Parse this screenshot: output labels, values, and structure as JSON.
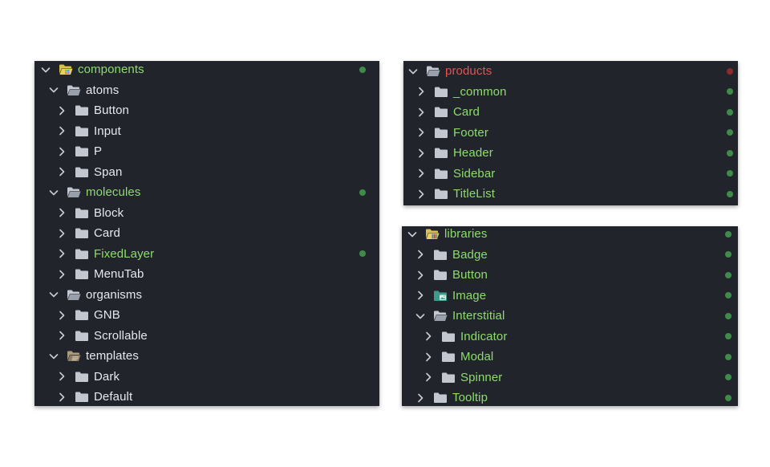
{
  "colors": {
    "panel_bg": "#22242c",
    "text_default": "#e6e8ee",
    "text_modified": "#8ddc6b",
    "text_error": "#e5524f",
    "folder_icon": "#c3c7d0",
    "dot_green": "#3f8c4a",
    "dot_red": "#8c2b2b",
    "chevron": "#c8cbd3"
  },
  "left_panel": {
    "items": [
      {
        "label": "components",
        "depth": 0,
        "expanded": true,
        "color": "green",
        "icon": "components-folder-icon",
        "dot": "green"
      },
      {
        "label": "atoms",
        "depth": 1,
        "expanded": true,
        "color": "default",
        "icon": "folder-open-icon"
      },
      {
        "label": "Button",
        "depth": 2,
        "expanded": false,
        "color": "default",
        "icon": "folder-icon"
      },
      {
        "label": "Input",
        "depth": 2,
        "expanded": false,
        "color": "default",
        "icon": "folder-icon"
      },
      {
        "label": "P",
        "depth": 2,
        "expanded": false,
        "color": "default",
        "icon": "folder-icon"
      },
      {
        "label": "Span",
        "depth": 2,
        "expanded": false,
        "color": "default",
        "icon": "folder-icon"
      },
      {
        "label": "molecules",
        "depth": 1,
        "expanded": true,
        "color": "green",
        "icon": "folder-open-icon",
        "dot": "green"
      },
      {
        "label": "Block",
        "depth": 2,
        "expanded": false,
        "color": "default",
        "icon": "folder-icon"
      },
      {
        "label": "Card",
        "depth": 2,
        "expanded": false,
        "color": "default",
        "icon": "folder-icon"
      },
      {
        "label": "FixedLayer",
        "depth": 2,
        "expanded": false,
        "color": "green",
        "icon": "folder-icon",
        "dot": "green"
      },
      {
        "label": "MenuTab",
        "depth": 2,
        "expanded": false,
        "color": "default",
        "icon": "folder-icon"
      },
      {
        "label": "organisms",
        "depth": 1,
        "expanded": true,
        "color": "default",
        "icon": "folder-open-icon"
      },
      {
        "label": "GNB",
        "depth": 2,
        "expanded": false,
        "color": "default",
        "icon": "folder-icon"
      },
      {
        "label": "Scrollable",
        "depth": 2,
        "expanded": false,
        "color": "default",
        "icon": "folder-icon"
      },
      {
        "label": "templates",
        "depth": 1,
        "expanded": true,
        "color": "default",
        "icon": "templates-folder-icon"
      },
      {
        "label": "Dark",
        "depth": 2,
        "expanded": false,
        "color": "default",
        "icon": "folder-icon"
      },
      {
        "label": "Default",
        "depth": 2,
        "expanded": false,
        "color": "default",
        "icon": "folder-icon"
      }
    ]
  },
  "top_right_panel": {
    "items": [
      {
        "label": "products",
        "depth": 0,
        "expanded": true,
        "color": "red",
        "icon": "folder-open-icon",
        "dot": "red"
      },
      {
        "label": "_common",
        "depth": 1,
        "expanded": false,
        "color": "green",
        "icon": "folder-icon",
        "dot": "green"
      },
      {
        "label": "Card",
        "depth": 1,
        "expanded": false,
        "color": "green",
        "icon": "folder-icon",
        "dot": "green"
      },
      {
        "label": "Footer",
        "depth": 1,
        "expanded": false,
        "color": "green",
        "icon": "folder-icon",
        "dot": "green"
      },
      {
        "label": "Header",
        "depth": 1,
        "expanded": false,
        "color": "green",
        "icon": "folder-icon",
        "dot": "green"
      },
      {
        "label": "Sidebar",
        "depth": 1,
        "expanded": false,
        "color": "green",
        "icon": "folder-icon",
        "dot": "green"
      },
      {
        "label": "TitleList",
        "depth": 1,
        "expanded": false,
        "color": "green",
        "icon": "folder-icon",
        "dot": "green"
      }
    ]
  },
  "bottom_right_panel": {
    "items": [
      {
        "label": "libraries",
        "depth": 0,
        "expanded": true,
        "color": "green",
        "icon": "libraries-folder-icon",
        "dot": "green"
      },
      {
        "label": "Badge",
        "depth": 1,
        "expanded": false,
        "color": "green",
        "icon": "folder-icon",
        "dot": "green"
      },
      {
        "label": "Button",
        "depth": 1,
        "expanded": false,
        "color": "green",
        "icon": "folder-icon",
        "dot": "green"
      },
      {
        "label": "Image",
        "depth": 1,
        "expanded": false,
        "color": "green",
        "icon": "image-folder-icon",
        "dot": "green"
      },
      {
        "label": "Interstitial",
        "depth": 1,
        "expanded": true,
        "color": "green",
        "icon": "folder-open-icon",
        "dot": "green"
      },
      {
        "label": "Indicator",
        "depth": 2,
        "expanded": false,
        "color": "green",
        "icon": "folder-icon",
        "dot": "green"
      },
      {
        "label": "Modal",
        "depth": 2,
        "expanded": false,
        "color": "green",
        "icon": "folder-icon",
        "dot": "green"
      },
      {
        "label": "Spinner",
        "depth": 2,
        "expanded": false,
        "color": "green",
        "icon": "folder-icon",
        "dot": "green"
      },
      {
        "label": "Tooltip",
        "depth": 1,
        "expanded": false,
        "color": "green",
        "icon": "folder-icon",
        "dot": "green"
      }
    ]
  }
}
